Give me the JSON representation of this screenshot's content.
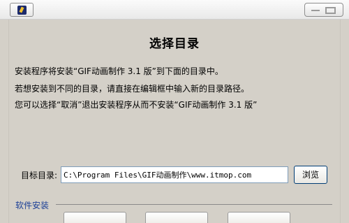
{
  "titlebar": {
    "app_icon": "installer-icon",
    "controls": [
      "minimize-icon",
      "maximize-icon"
    ]
  },
  "page": {
    "heading": "选择目录",
    "lines": [
      "安装程序将安装“GIF动画制作 3.1 版”到下面的目录中。",
      "若想安装到不同的目录，请直接在编辑框中输入新的目录路径。",
      "您可以选择“取消”退出安装程序从而不安装“GIF动画制作 3.1 版”"
    ]
  },
  "target_dir": {
    "label": "目标目录:",
    "value": "C:\\Program Files\\GIF动画制作\\www.itmop.com",
    "browse_label": "浏览"
  },
  "group": {
    "label": "软件安装"
  }
}
